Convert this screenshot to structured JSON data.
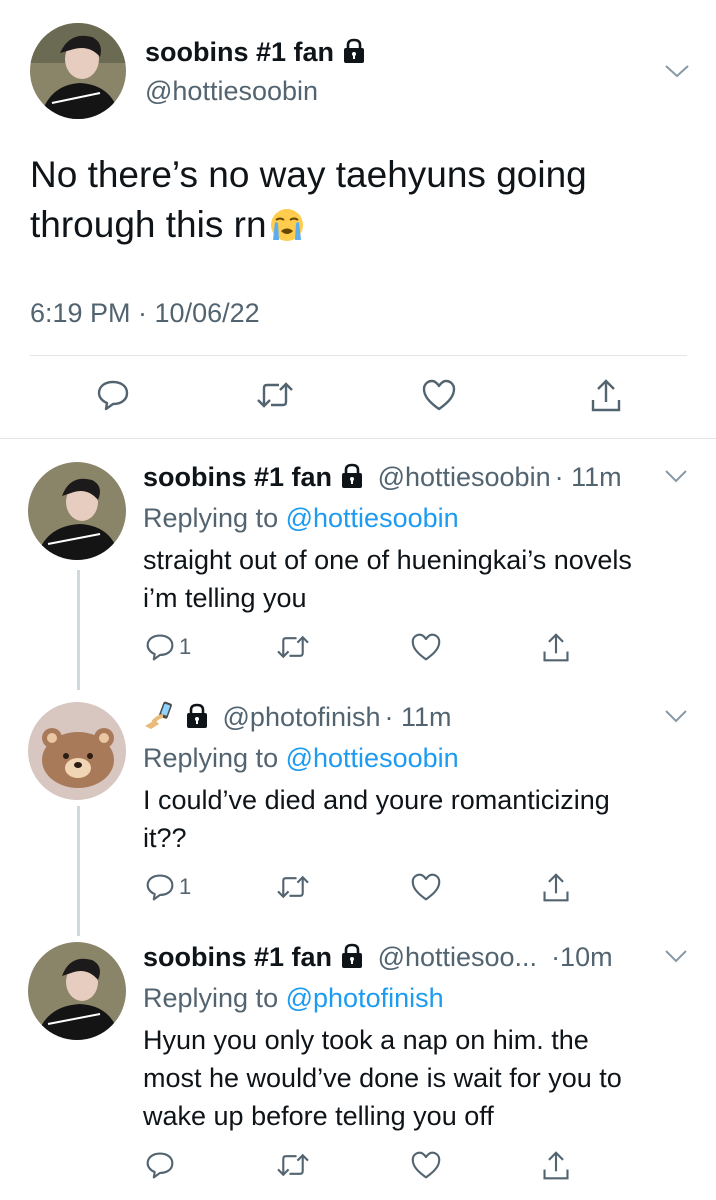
{
  "main_tweet": {
    "display_name": "soobins #1 fan",
    "handle": "@hottiesoobin",
    "text": "No there’s no way taehyuns going through this rn",
    "emoji": "loudly-crying-face",
    "timestamp": "6:19 PM · 10/06/22",
    "icons": [
      "comment-icon",
      "retweet-icon",
      "like-icon",
      "share-icon"
    ]
  },
  "replies": [
    {
      "display_name": "soobins #1 fan",
      "handle": "@hottiesoobin",
      "time": "· 11m",
      "replying_prefix": "Replying to",
      "replying_to": "@hottiesoobin",
      "text_lines": [
        "straight out of one of hueningkai’s novels",
        "i’m telling you"
      ],
      "reply_count": "1"
    },
    {
      "display_name": "",
      "name_icons": [
        "phone-in-hand-icon",
        "lock-icon"
      ],
      "handle": "@photofinish",
      "time": "· 11m",
      "replying_prefix": "Replying to",
      "replying_to": "@hottiesoobin",
      "text_lines": [
        "I could’ve died and youre romanticizing",
        "it??"
      ],
      "reply_count": "1"
    },
    {
      "display_name": "soobins #1 fan",
      "handle": "@hottiesoo...",
      "time": "·10m",
      "replying_prefix": "Replying to",
      "replying_to": "@photofinish",
      "text_lines": [
        "Hyun you only took a nap on him. the",
        "most he would’ve done is wait for you to",
        "wake up before telling you off"
      ],
      "reply_count": ""
    }
  ],
  "colors": {
    "text": "#0f1419",
    "secondary": "#536471",
    "link": "#1d9bf0",
    "divider": "#e3e6e9",
    "thread_line": "#cfd9de"
  }
}
